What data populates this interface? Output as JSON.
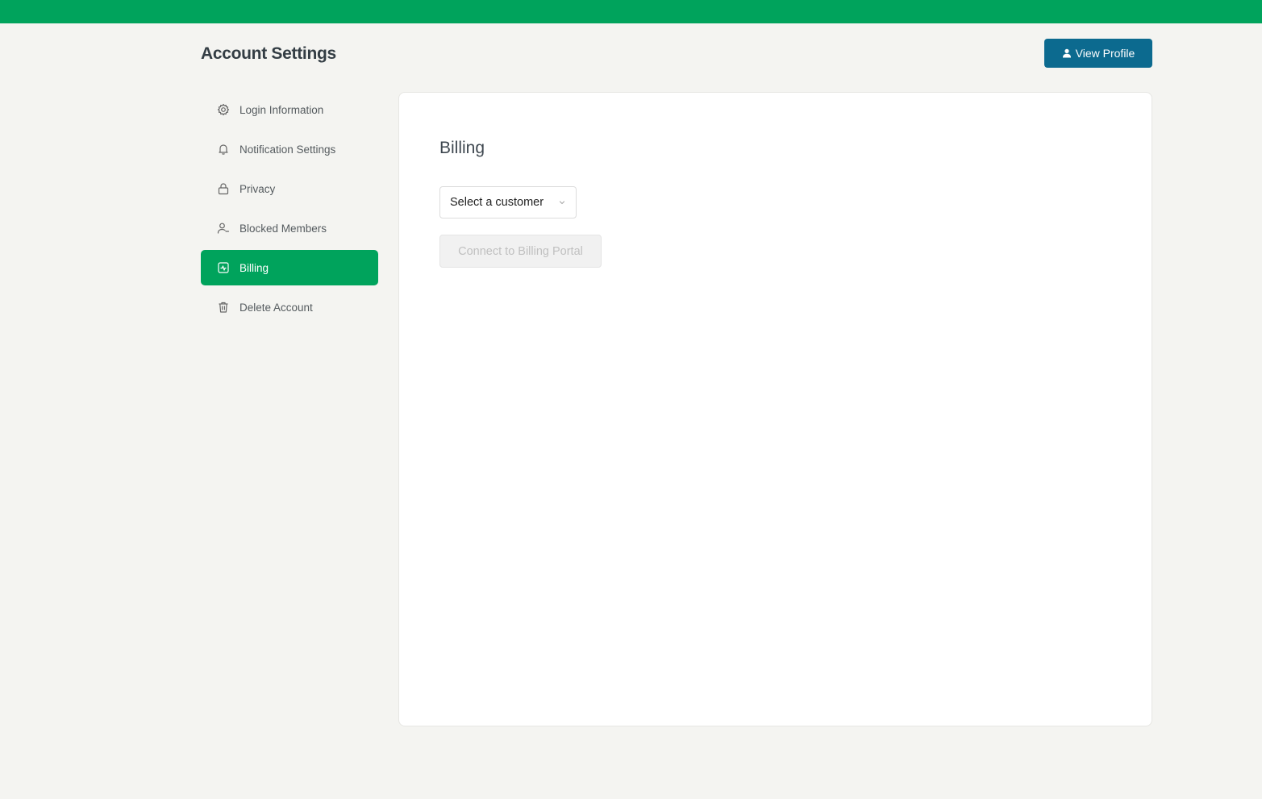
{
  "colors": {
    "brand_green": "#00a35c",
    "primary_blue": "#0c6a8f",
    "page_bg": "#f4f4f1"
  },
  "header": {
    "title": "Account Settings",
    "view_profile": {
      "label": "View Profile",
      "icon": "user-icon"
    }
  },
  "sidebar": {
    "items": [
      {
        "label": "Login Information",
        "icon": "gear-icon",
        "active": false
      },
      {
        "label": "Notification Settings",
        "icon": "bell-icon",
        "active": false
      },
      {
        "label": "Privacy",
        "icon": "lock-icon",
        "active": false
      },
      {
        "label": "Blocked Members",
        "icon": "user-blocked-icon",
        "active": false
      },
      {
        "label": "Billing",
        "icon": "billing-icon",
        "active": true
      },
      {
        "label": "Delete Account",
        "icon": "trash-icon",
        "active": false
      }
    ]
  },
  "main": {
    "title": "Billing",
    "customer_select": {
      "value": "Select a customer",
      "icon": "chevron-down-icon"
    },
    "connect_button": {
      "label": "Connect to Billing Portal",
      "disabled": true
    }
  }
}
